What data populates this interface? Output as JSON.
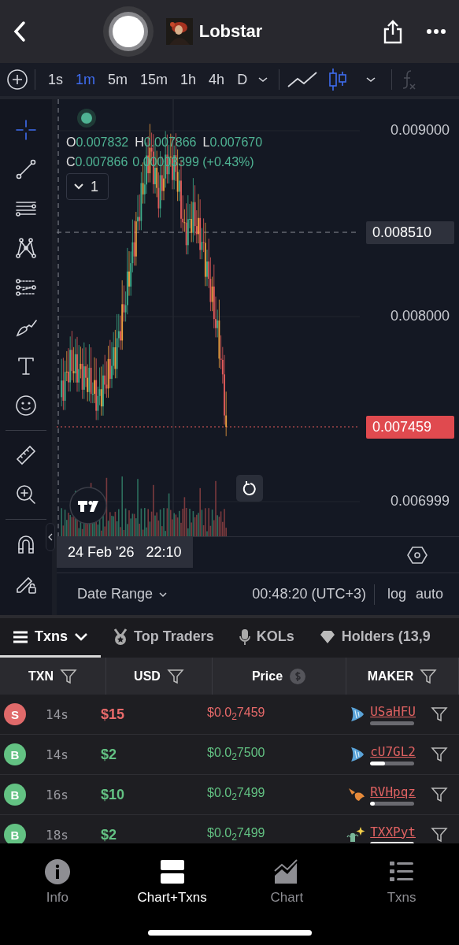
{
  "header": {
    "title": "Lobstar"
  },
  "toolbar": {
    "intervals": [
      {
        "label": "1s",
        "selected": false
      },
      {
        "label": "1m",
        "selected": true
      },
      {
        "label": "5m",
        "selected": false
      },
      {
        "label": "15m",
        "selected": false
      },
      {
        "label": "1h",
        "selected": false
      },
      {
        "label": "4h",
        "selected": false
      },
      {
        "label": "D",
        "selected": false
      }
    ],
    "chart_types": [
      {
        "kind": "line",
        "selected": false
      },
      {
        "kind": "candles",
        "selected": true
      }
    ]
  },
  "drawing_tools": [
    {
      "kind": "crosshair",
      "selected": true
    },
    {
      "kind": "trend-line",
      "selected": false
    },
    {
      "kind": "h-lines",
      "selected": false
    },
    {
      "kind": "pattern",
      "selected": false
    },
    {
      "kind": "fib",
      "selected": false
    },
    {
      "kind": "brush",
      "selected": false
    },
    {
      "kind": "text",
      "selected": false
    },
    {
      "kind": "emoji",
      "selected": false
    },
    {
      "kind": "ruler",
      "selected": false
    },
    {
      "kind": "zoom",
      "selected": false
    },
    {
      "kind": "magnet",
      "selected": false
    },
    {
      "kind": "lock",
      "selected": false
    }
  ],
  "chart": {
    "legend": [
      {
        "label": "O",
        "value": "0.007832"
      },
      {
        "label": "H",
        "value": "0.007866"
      },
      {
        "label": "L",
        "value": "0.007670"
      },
      {
        "label": "C",
        "value": "0.007866"
      }
    ],
    "change": "0.00003399 (+0.43%)",
    "indicator_count": "1",
    "price_scale": [
      "0.009000",
      "0.008000",
      "0.006999"
    ],
    "crosshair_price": "0.008510",
    "last_price": "0.007459",
    "crosshair_time": "24 Feb '26   22:10"
  },
  "chart_footer": {
    "date_range": "Date Range",
    "clock": "00:48:20 (UTC+3)",
    "scale_modes": [
      "log",
      "auto"
    ]
  },
  "tabs": [
    {
      "label": "Txns",
      "kind": "menu",
      "selected": true
    },
    {
      "label": "Top Traders",
      "kind": "medal",
      "selected": false
    },
    {
      "label": "KOLs",
      "kind": "mic",
      "selected": false
    },
    {
      "label": "Holders (13,9",
      "kind": "diamond",
      "selected": false
    }
  ],
  "table": {
    "columns": [
      {
        "label": "TXN",
        "kind": "filter"
      },
      {
        "label": "USD",
        "kind": "filter"
      },
      {
        "label": "Price",
        "kind": "currency"
      },
      {
        "label": "MAKER",
        "kind": "filter"
      }
    ],
    "rows": [
      {
        "kind": "sell",
        "side": "S",
        "age": "14s",
        "usd": "$15",
        "price": "$0.0$_{2}$7459",
        "maker": {
          "name": "USaHFU",
          "kind": "fish",
          "level": 0
        }
      },
      {
        "kind": "buy",
        "side": "B",
        "age": "14s",
        "usd": "$2",
        "price": "$0.0$_{2}$7500",
        "maker": {
          "name": "cU7GL2",
          "kind": "fish",
          "level": 0.33
        }
      },
      {
        "kind": "buy",
        "side": "B",
        "age": "16s",
        "usd": "$10",
        "price": "$0.0$_{2}$7499",
        "maker": {
          "name": "RVHpqz",
          "kind": "bird",
          "level": 0.1
        }
      },
      {
        "kind": "buy",
        "side": "B",
        "age": "18s",
        "usd": "$2",
        "price": "$0.0$_{2}$7499",
        "maker": {
          "name": "TXXPyt",
          "kind": "sparkle",
          "level": 1
        }
      }
    ]
  },
  "bottom_nav": [
    {
      "label": "Info",
      "kind": "info",
      "selected": false
    },
    {
      "label": "Chart+Txns",
      "kind": "split",
      "selected": true
    },
    {
      "label": "Chart",
      "kind": "chart",
      "selected": false
    },
    {
      "label": "Txns",
      "kind": "list",
      "selected": false
    }
  ]
}
